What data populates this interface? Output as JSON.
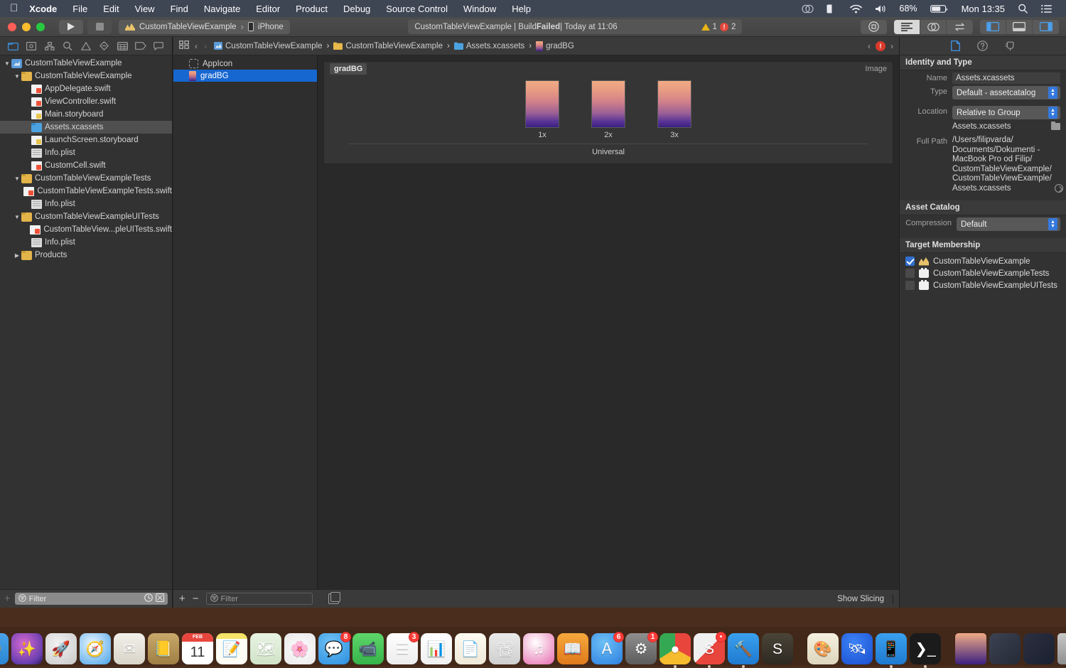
{
  "menubar": {
    "apple_icon": "apple-logo",
    "items": [
      "Xcode",
      "File",
      "Edit",
      "View",
      "Find",
      "Navigate",
      "Editor",
      "Product",
      "Debug",
      "Source Control",
      "Window",
      "Help"
    ],
    "app_name": "Xcode",
    "status": {
      "creative_cloud_icon": "creative-cloud-icon",
      "displays_icon": "displays-icon",
      "wifi_icon": "wifi-icon",
      "volume_icon": "volume-icon",
      "battery_percent": "68%",
      "battery_icon": "battery-icon",
      "clock": "Mon 13:35",
      "search_icon": "spotlight-search-icon",
      "control_center_icon": "notification-center-icon"
    }
  },
  "toolbar": {
    "run_icon": "play-icon",
    "stop_icon": "stop-icon",
    "scheme_name": "CustomTableViewExample",
    "scheme_separator": "›",
    "destination": "iPhone",
    "status": {
      "text": "CustomTableViewExample | Build ",
      "bold": "Failed",
      "text_after": " | Today at 11:06",
      "warning_count": "1",
      "error_count": "2",
      "error_badge": "!"
    },
    "library_icon": "library-icon",
    "editor_segments": [
      {
        "name": "standard-editor",
        "icon": "lines-icon",
        "active": true
      },
      {
        "name": "assistant-editor",
        "icon": "venn-icon",
        "active": false
      },
      {
        "name": "version-editor",
        "icon": "arrows-icon",
        "active": false
      }
    ],
    "panel_toggles": [
      {
        "name": "toggle-navigator",
        "icon": "left-panel-icon"
      },
      {
        "name": "toggle-debug-area",
        "icon": "bottom-panel-icon"
      },
      {
        "name": "toggle-inspector",
        "icon": "right-panel-icon"
      }
    ]
  },
  "navigator": {
    "tabs": [
      {
        "name": "project-navigator",
        "icon": "folder-icon",
        "active": true
      },
      {
        "name": "source-control-navigator",
        "icon": "source-control-icon",
        "active": false
      },
      {
        "name": "symbol-navigator",
        "icon": "symbol-icon",
        "active": false
      },
      {
        "name": "find-navigator",
        "icon": "search-icon",
        "active": false
      },
      {
        "name": "issue-navigator",
        "icon": "warning-triangle-icon",
        "active": false
      },
      {
        "name": "test-navigator",
        "icon": "diamond-icon",
        "active": false
      },
      {
        "name": "debug-navigator",
        "icon": "debug-icon",
        "active": false
      },
      {
        "name": "breakpoint-navigator",
        "icon": "breakpoint-icon",
        "active": false
      },
      {
        "name": "report-navigator",
        "icon": "message-icon",
        "active": false
      }
    ],
    "tree": [
      {
        "label": "CustomTableViewExample",
        "indent": 0,
        "twisty": "down",
        "icon": "project",
        "selected": false
      },
      {
        "label": "CustomTableViewExample",
        "indent": 1,
        "twisty": "down",
        "icon": "folder",
        "selected": false
      },
      {
        "label": "AppDelegate.swift",
        "indent": 2,
        "twisty": "none",
        "icon": "swift",
        "selected": false
      },
      {
        "label": "ViewController.swift",
        "indent": 2,
        "twisty": "none",
        "icon": "swift",
        "selected": false
      },
      {
        "label": "Main.storyboard",
        "indent": 2,
        "twisty": "none",
        "icon": "storyboard",
        "selected": false
      },
      {
        "label": "Assets.xcassets",
        "indent": 2,
        "twisty": "none",
        "icon": "assets",
        "selected": true
      },
      {
        "label": "LaunchScreen.storyboard",
        "indent": 2,
        "twisty": "none",
        "icon": "storyboard",
        "selected": false
      },
      {
        "label": "Info.plist",
        "indent": 2,
        "twisty": "none",
        "icon": "plist",
        "selected": false
      },
      {
        "label": "CustomCell.swift",
        "indent": 2,
        "twisty": "none",
        "icon": "swift",
        "selected": false
      },
      {
        "label": "CustomTableViewExampleTests",
        "indent": 1,
        "twisty": "down",
        "icon": "folder",
        "selected": false
      },
      {
        "label": "CustomTableViewExampleTests.swift",
        "indent": 2,
        "twisty": "none",
        "icon": "swift",
        "selected": false
      },
      {
        "label": "Info.plist",
        "indent": 2,
        "twisty": "none",
        "icon": "plist",
        "selected": false
      },
      {
        "label": "CustomTableViewExampleUITests",
        "indent": 1,
        "twisty": "down",
        "icon": "folder",
        "selected": false
      },
      {
        "label": "CustomTableView...pleUITests.swift",
        "indent": 2,
        "twisty": "none",
        "icon": "swift",
        "selected": false
      },
      {
        "label": "Info.plist",
        "indent": 2,
        "twisty": "none",
        "icon": "plist",
        "selected": false
      },
      {
        "label": "Products",
        "indent": 1,
        "twisty": "right",
        "icon": "folder",
        "selected": false
      }
    ],
    "filter_placeholder": "Filter",
    "filter_icon": "filter-icon",
    "recent_icon": "clock-icon",
    "unsaved_icon": "source-control-filter-icon",
    "add_icon": "+"
  },
  "jumpbar": {
    "related_items_icon": "related-items-icon",
    "back_icon": "‹",
    "forward_icon": "›",
    "crumbs": [
      {
        "label": "CustomTableViewExample",
        "icon": "project-icon"
      },
      {
        "label": "CustomTableViewExample",
        "icon": "folder-icon"
      },
      {
        "label": "Assets.xcassets",
        "icon": "assets-icon"
      },
      {
        "label": "gradBG",
        "icon": "image-set-icon"
      }
    ],
    "issue_prev_icon": "‹",
    "issue_badge": "!",
    "issue_next_icon": "›"
  },
  "asset_catalog": {
    "items": [
      {
        "label": "AppIcon",
        "icon": "app-icon-placeholder",
        "selected": false
      },
      {
        "label": "gradBG",
        "icon": "gradient-thumbnail",
        "selected": true
      }
    ],
    "canvas": {
      "set_name": "gradBG",
      "kind_label": "Image",
      "scales": [
        "1x",
        "2x",
        "3x"
      ],
      "device_label": "Universal",
      "gradient_top": "#f0ab85",
      "gradient_bottom": "#3b2080"
    },
    "bottom": {
      "add_icon": "+",
      "remove_icon": "−",
      "filter_placeholder": "Filter",
      "filter_icon": "filter-icon",
      "slicing_icon": "slicing-icon",
      "show_slicing_label": "Show Slicing"
    }
  },
  "inspector": {
    "tabs": [
      {
        "name": "file-inspector",
        "icon": "document-icon",
        "active": true
      },
      {
        "name": "quick-help-inspector",
        "icon": "question-circle-icon",
        "active": false
      },
      {
        "name": "unknown-inspector",
        "icon": "plug-icon",
        "active": false
      }
    ],
    "identity_and_type": {
      "title": "Identity and Type",
      "name_label": "Name",
      "name_value": "Assets.xcassets",
      "type_label": "Type",
      "type_value": "Default - assetcatalog",
      "location_label": "Location",
      "location_value": "Relative to Group",
      "location_file": "Assets.xcassets",
      "choose_folder_icon": "folder-icon",
      "full_path_label": "Full Path",
      "full_path_value": "/Users/filipvarda/ Documents/Dokumenti - MacBook Pro od Filip/ CustomTableViewExample/ CustomTableViewExample/ Assets.xcassets",
      "reveal_icon": "reveal-in-finder-icon"
    },
    "asset_catalog": {
      "title": "Asset Catalog",
      "compression_label": "Compression",
      "compression_value": "Default"
    },
    "target_membership": {
      "title": "Target Membership",
      "targets": [
        {
          "label": "CustomTableViewExample",
          "checked": true,
          "icon": "app-target-icon"
        },
        {
          "label": "CustomTableViewExampleTests",
          "checked": false,
          "icon": "test-target-icon"
        },
        {
          "label": "CustomTableViewExampleUITests",
          "checked": false,
          "icon": "test-target-icon"
        }
      ]
    }
  },
  "dock": {
    "items": [
      {
        "name": "finder",
        "glyph": "🙂",
        "bg": "linear-gradient(180deg,#4aa3e8,#2b87d4)",
        "running": true,
        "badge": null
      },
      {
        "name": "siri",
        "glyph": "✨",
        "bg": "radial-gradient(circle at 40% 35%,#d96ad0,#6a3fb0 70%,#2b1a5e)",
        "running": false,
        "badge": null
      },
      {
        "name": "launchpad",
        "glyph": "🚀",
        "bg": "radial-gradient(circle at 40% 35%,#f2f2f2,#c8c8c8)",
        "running": false,
        "badge": null
      },
      {
        "name": "safari",
        "glyph": "🧭",
        "bg": "radial-gradient(circle at 40% 35%,#eaf6ff,#4aa3e8)",
        "running": false,
        "badge": null
      },
      {
        "name": "mail",
        "glyph": "✉",
        "bg": "linear-gradient(180deg,#f2f0ea,#d8d4c8)",
        "running": false,
        "badge": null
      },
      {
        "name": "contacts",
        "glyph": "📒",
        "bg": "linear-gradient(180deg,#c9a86a,#a07f46)",
        "running": false,
        "badge": null
      },
      {
        "name": "calendar",
        "glyph": "11",
        "bg": "#ffffff",
        "running": false,
        "badge": null
      },
      {
        "name": "notes",
        "glyph": "📝",
        "bg": "linear-gradient(180deg,#f5e36a 0 18%,#fdfdf5 18%)",
        "running": false,
        "badge": null
      },
      {
        "name": "maps",
        "glyph": "🗺",
        "bg": "linear-gradient(180deg,#e9f3e3,#cfe3c8)",
        "running": false,
        "badge": null
      },
      {
        "name": "photos",
        "glyph": "🌸",
        "bg": "radial-gradient(circle at 50% 50%,#ffffff,#e8e8e8)",
        "running": false,
        "badge": null
      },
      {
        "name": "messages",
        "glyph": "💬",
        "bg": "radial-gradient(circle at 40% 30%,#6ec0f5,#2b8fe0)",
        "running": false,
        "badge": "8"
      },
      {
        "name": "facetime",
        "glyph": "📹",
        "bg": "linear-gradient(180deg,#5ed66a,#36b44a)",
        "running": false,
        "badge": null
      },
      {
        "name": "reminders",
        "glyph": "☰",
        "bg": "linear-gradient(180deg,#ffffff,#ececec)",
        "running": false,
        "badge": "3"
      },
      {
        "name": "numbers",
        "glyph": "📊",
        "bg": "linear-gradient(180deg,#ffffff,#f0f0f0)",
        "running": false,
        "badge": null
      },
      {
        "name": "pages",
        "glyph": "📄",
        "bg": "linear-gradient(180deg,#fdfbf2,#efe8d8)",
        "running": false,
        "badge": null
      },
      {
        "name": "keynote",
        "glyph": "📽",
        "bg": "linear-gradient(180deg,#eaeaea,#cfcfcf)",
        "running": false,
        "badge": null
      },
      {
        "name": "itunes",
        "glyph": "♫",
        "bg": "radial-gradient(circle at 40% 30%,#ffffff,#f0a8cf 60%,#e86ab0)",
        "running": false,
        "badge": null
      },
      {
        "name": "ibooks",
        "glyph": "📖",
        "bg": "linear-gradient(180deg,#f5a93c,#e07a1c)",
        "running": false,
        "badge": null
      },
      {
        "name": "app-store",
        "glyph": "Ａ",
        "bg": "radial-gradient(circle at 40% 30%,#6ec0f5,#2b7fe0)",
        "running": false,
        "badge": "6"
      },
      {
        "name": "system-preferences",
        "glyph": "⚙",
        "bg": "linear-gradient(180deg,#8f8f8f,#5c5c5c)",
        "running": false,
        "badge": "1"
      },
      {
        "name": "google-chrome",
        "glyph": "●",
        "bg": "conic-gradient(#e8453c 0 33%,#f7bb2e 33% 66%,#34a853 66%)",
        "running": true,
        "badge": null
      },
      {
        "name": "slack",
        "glyph": "S",
        "bg": "linear-gradient(135deg,#f0f0f0 50%,#e8453c 50%)",
        "running": true,
        "badge": "•"
      },
      {
        "name": "xcode",
        "glyph": "🔨",
        "bg": "linear-gradient(180deg,#3aa0ee,#1f7ad0)",
        "running": true,
        "badge": null
      },
      {
        "name": "sublime-text",
        "glyph": "S",
        "bg": "linear-gradient(180deg,#4a4438,#2e2a22)",
        "running": false,
        "badge": null
      },
      {
        "name": "separator",
        "glyph": "",
        "bg": "",
        "running": false,
        "badge": null
      },
      {
        "name": "paint-app",
        "glyph": "🎨",
        "bg": "linear-gradient(180deg,#f5f0e0,#ded6bd)",
        "running": false,
        "badge": null
      },
      {
        "name": "postman",
        "glyph": "🛰",
        "bg": "radial-gradient(circle at 40% 30%,#3b82f6,#1b4fd0)",
        "running": false,
        "badge": null
      },
      {
        "name": "xcode-simulator",
        "glyph": "📱",
        "bg": "linear-gradient(180deg,#3aa0ee,#1f7ad0)",
        "running": true,
        "badge": null
      },
      {
        "name": "terminal",
        "glyph": "❯_",
        "bg": "#1b1b1b",
        "running": true,
        "badge": null
      },
      {
        "name": "separator-2",
        "glyph": "",
        "bg": "",
        "running": false,
        "badge": null
      },
      {
        "name": "downloads-stack",
        "glyph": "",
        "bg": "linear-gradient(180deg,#f0ab85,#3b2080)",
        "running": false,
        "badge": null
      },
      {
        "name": "minimized-window-1",
        "glyph": "",
        "bg": "linear-gradient(135deg,#3c4252,#252a36)",
        "running": false,
        "badge": null
      },
      {
        "name": "minimized-window-2",
        "glyph": "",
        "bg": "linear-gradient(135deg,#2b3040,#1b2030)",
        "running": false,
        "badge": null
      },
      {
        "name": "trash",
        "glyph": "🗑",
        "bg": "linear-gradient(180deg,#c8c8c8,#8f8f8f)",
        "running": false,
        "badge": null
      }
    ]
  }
}
